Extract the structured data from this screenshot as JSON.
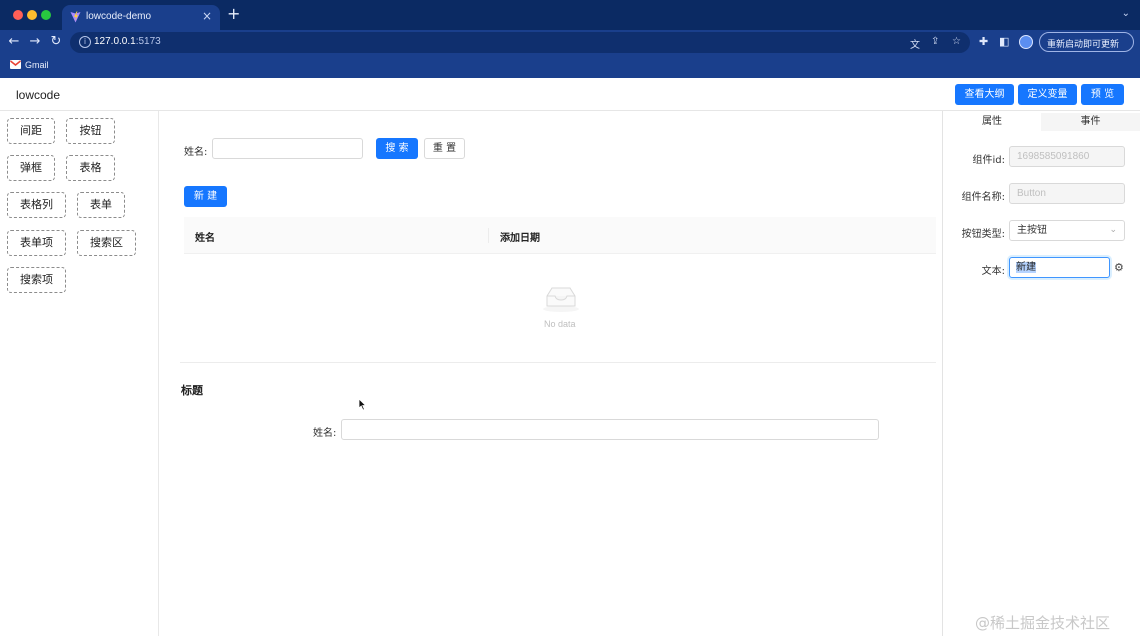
{
  "browser": {
    "tab_title": "lowcode-demo",
    "tab_close_symbol": "×",
    "new_tab_symbol": "+",
    "url_host": "127.0.0.1",
    "url_port": ":5173",
    "update_button": "重新启动即可更新",
    "bookmark_gmail": "Gmail"
  },
  "app": {
    "title": "lowcode",
    "header_buttons": [
      "查看大纲",
      "定义变量",
      "预 览"
    ],
    "accent_color": "#1677ff"
  },
  "components": [
    "间距",
    "按钮",
    "弹框",
    "表格",
    "表格列",
    "表单",
    "表单项",
    "搜索区",
    "搜索项"
  ],
  "canvas": {
    "search": {
      "name_label": "姓名:",
      "search_button": "搜 索",
      "reset_button": "重 置"
    },
    "new_button": "新 建",
    "table": {
      "columns": [
        "姓名",
        "添加日期"
      ],
      "empty_text": "No data"
    },
    "form": {
      "title": "标题",
      "name_label": "姓名:"
    }
  },
  "props_panel": {
    "tabs": [
      "属性",
      "事件"
    ],
    "fields": {
      "id_label": "组件id:",
      "id_value": "1698585091860",
      "name_label": "组件名称:",
      "name_value": "Button",
      "type_label": "按钮类型:",
      "type_value": "主按钮",
      "text_label": "文本:",
      "text_value": "新建"
    }
  },
  "watermark": "@稀土掘金技术社区"
}
